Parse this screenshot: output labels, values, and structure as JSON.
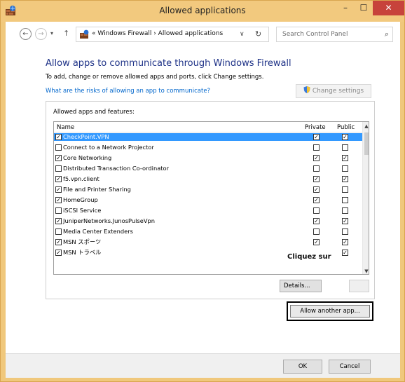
{
  "window": {
    "title": "Allowed applications",
    "minimize": "–",
    "maximize": "☐",
    "close": "✕",
    "accent_color": "#f2c97e"
  },
  "nav": {
    "back": "←",
    "forward": "→",
    "dropdown": "▾",
    "up": "↑",
    "breadcrumb": "« Windows Firewall › Allowed applications",
    "address_chevron": "∨",
    "refresh": "↻",
    "search_placeholder": "Search Control Panel",
    "search_icon": "⌕"
  },
  "main": {
    "heading": "Allow apps to communicate through Windows Firewall",
    "subheading": "To add, change or remove allowed apps and ports, click Change settings.",
    "risk_link": "What are the risks of allowing an app to communicate?",
    "change_settings": "Change settings",
    "group_title": "Allowed apps and features:",
    "columns": {
      "name": "Name",
      "private": "Private",
      "public": "Public"
    },
    "rows": [
      {
        "name": "CheckPoint.VPN",
        "enabled": "☑",
        "private": "☑",
        "public": "☑",
        "selected": true
      },
      {
        "name": "Connect to a Network Projector",
        "enabled": "☐",
        "private": "☐",
        "public": "☐"
      },
      {
        "name": "Core Networking",
        "enabled": "☑",
        "private": "☑",
        "public": "☑"
      },
      {
        "name": "Distributed Transaction Co-ordinator",
        "enabled": "☐",
        "private": "☐",
        "public": "☐"
      },
      {
        "name": "f5.vpn.client",
        "enabled": "☑",
        "private": "☑",
        "public": "☑"
      },
      {
        "name": "File and Printer Sharing",
        "enabled": "☑",
        "private": "☑",
        "public": "☐"
      },
      {
        "name": "HomeGroup",
        "enabled": "☑",
        "private": "☑",
        "public": "☐"
      },
      {
        "name": "iSCSI Service",
        "enabled": "☐",
        "private": "☐",
        "public": "☐"
      },
      {
        "name": "JuniperNetworks.JunosPulseVpn",
        "enabled": "☑",
        "private": "☑",
        "public": "☑"
      },
      {
        "name": "Media Center Extenders",
        "enabled": "☐",
        "private": "☐",
        "public": "☐"
      },
      {
        "name": "MSN スポーツ",
        "enabled": "☑",
        "private": "☑",
        "public": "☑"
      },
      {
        "name": "MSN トラベル",
        "enabled": "☑",
        "private": "☑",
        "public": "☑"
      }
    ],
    "details_button": "Details...",
    "tooltip": "Cliquez sur",
    "allow_another": "Allow another app..."
  },
  "footer": {
    "ok": "OK",
    "cancel": "Cancel"
  }
}
